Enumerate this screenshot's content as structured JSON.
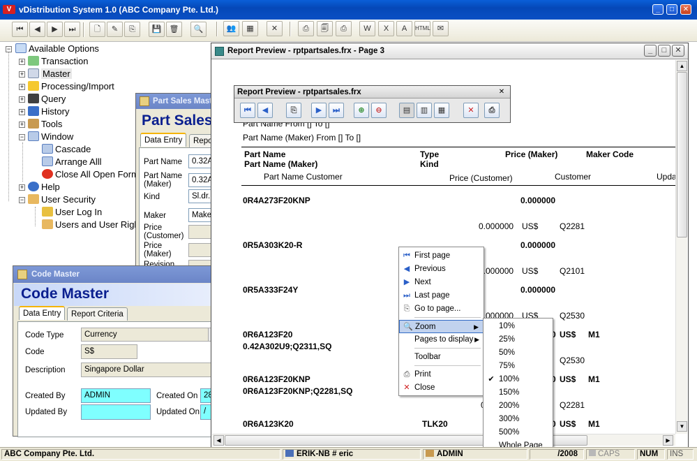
{
  "main_window": {
    "title": "vDistribution System 1.0 (ABC Company Pte. Ltd.)"
  },
  "toolbar_icons": [
    "first-record",
    "previous-record",
    "next-record",
    "last-record",
    "new",
    "edit",
    "copy",
    "save",
    "delete",
    "find",
    "users",
    "report",
    "cancel",
    "print",
    "print-preview",
    "print-setup",
    "export-word",
    "export-excel",
    "export-pdf",
    "export-html",
    "email"
  ],
  "tree": {
    "root": "Available Options",
    "items": [
      {
        "label": "Transaction"
      },
      {
        "label": "Master"
      },
      {
        "label": "Processing/Import"
      },
      {
        "label": "Query"
      },
      {
        "label": "History"
      },
      {
        "label": "Tools"
      },
      {
        "label": "Window"
      },
      {
        "label": "Cascade"
      },
      {
        "label": "Arrange Alll"
      },
      {
        "label": "Close All Open Form"
      },
      {
        "label": "Help"
      },
      {
        "label": "User Security"
      },
      {
        "label": "User Log In"
      },
      {
        "label": "Users and User Righ"
      }
    ]
  },
  "part_sales_window": {
    "title": "Part Sales Master",
    "heading": "Part Sales",
    "tabs": [
      "Data Entry",
      "Repor"
    ],
    "fields": [
      {
        "label": "Part Name",
        "value": "0.32A"
      },
      {
        "label": "Part Name (Maker)",
        "value": "0.32A"
      },
      {
        "label": "Kind",
        "value": "Sl.dr."
      },
      {
        "label": "Maker",
        "value": "Maker"
      },
      {
        "label": "Price (Customer)",
        "value": ""
      },
      {
        "label": "Price (Maker)",
        "value": ""
      },
      {
        "label": "Revision",
        "value": ""
      }
    ]
  },
  "code_master_window": {
    "title": "Code Master",
    "heading": "Code Master",
    "tabs": [
      "Data Entry",
      "Report Criteria"
    ],
    "code_type_label": "Code Type",
    "code_type_value": "Currency",
    "code_label": "Code",
    "code_value": "S$",
    "description_label": "Description",
    "description_value": "Singapore Dollar",
    "created_by_label": "Created By",
    "created_by_value": "ADMIN",
    "created_on_label": "Created On",
    "created_on_value": "28",
    "updated_by_label": "Updated By",
    "updated_by_value": "",
    "updated_on_label": "Updated On",
    "updated_on_value": "/"
  },
  "report_preview_window": {
    "title": "Report Preview - rptpartsales.frx - Page 3",
    "toolbar_title": "Report Preview - rptpartsales.frx",
    "report": {
      "header_line1": "Part Name From [] To []",
      "header_line2": "Part Name (Maker) From [] To []",
      "col_part_name": "Part Name",
      "col_part_name_maker": "Part Name (Maker)",
      "col_part_name_customer": "Part Name Customer",
      "col_type": "Type",
      "col_kind": "Kind",
      "col_price_maker": "Price (Maker)",
      "col_price_customer": "Price (Customer)",
      "col_maker_code": "Maker Code",
      "col_customer": "Customer",
      "col_upda": "Upda",
      "rows": [
        {
          "part": "0R4A273F20KNP",
          "maker_price": "0.000000",
          "cust_price": "0.000000",
          "cur": "US$",
          "cust": "Q2281"
        },
        {
          "part": "0R5A303K20-R",
          "maker_price": "0.000000",
          "cust_price": "0.000000",
          "cur": "US$",
          "cust": "Q2101"
        },
        {
          "part": "0R5A333F24Y",
          "maker_price": "0.000000",
          "cust_price": "0.000000",
          "cur": "US$",
          "cust": "Q2530"
        },
        {
          "part": "0R6A123F20",
          "sub": "0.42A302U9;Q2311,SQ",
          "maker_price": "0",
          "cur": "US$",
          "code": "M1",
          "cust": "Q2530"
        },
        {
          "part": "0R6A123F20KNP",
          "sub": "0R6A123F20KNP;Q2281,SQ",
          "maker_price": "0",
          "cur": "US$",
          "code": "M1",
          "cust": "Q2281",
          "cust_price": "0"
        },
        {
          "part": "0R6A123K20",
          "type": "TLK20",
          "maker_price": "0",
          "cur": "US$",
          "code": "M1"
        }
      ]
    }
  },
  "context_menu": {
    "items": [
      {
        "label": "First page",
        "icon": "first-page-icon"
      },
      {
        "label": "Previous",
        "icon": "previous-icon"
      },
      {
        "label": "Next",
        "icon": "next-icon"
      },
      {
        "label": "Last page",
        "icon": "last-page-icon"
      },
      {
        "label": "Go to page...",
        "icon": "goto-page-icon"
      },
      {
        "label": "Zoom",
        "icon": "zoom-icon"
      },
      {
        "label": "Pages to display",
        "icon": ""
      },
      {
        "label": "Toolbar",
        "icon": ""
      },
      {
        "label": "Print",
        "icon": "print-icon"
      },
      {
        "label": "Close",
        "icon": "close-icon"
      }
    ]
  },
  "zoom_submenu": {
    "items": [
      "10%",
      "25%",
      "50%",
      "75%",
      "100%",
      "150%",
      "200%",
      "300%",
      "500%",
      "Whole Page"
    ],
    "checked": "100%"
  },
  "status_bar": {
    "company": "ABC Company Pte. Ltd.",
    "computer": "ERIK-NB # eric",
    "user": "ADMIN",
    "date": "/2008",
    "caps": "CAPS",
    "num": "NUM",
    "ins": "INS"
  },
  "colors": {
    "title_blue": "#0548b8",
    "heading_blue": "#0a1f8f",
    "cyan_field": "#7fffff"
  }
}
